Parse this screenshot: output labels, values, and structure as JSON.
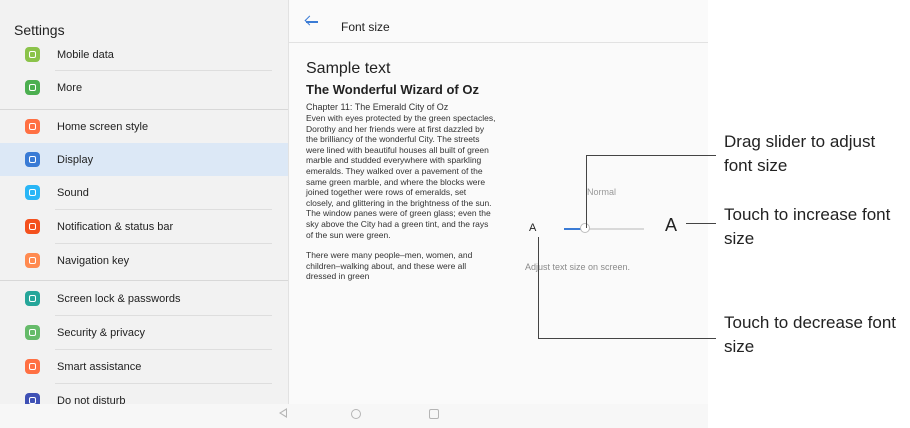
{
  "settings": {
    "header": "Settings",
    "items": [
      {
        "label": "Mobile data",
        "icon": "mobile-data-icon",
        "color": "#8bc34a"
      },
      {
        "label": "More",
        "icon": "more-icon",
        "color": "#4caf50"
      },
      {
        "label": "Home screen style",
        "icon": "home-screen-style-icon",
        "color": "#ff7043"
      },
      {
        "label": "Display",
        "icon": "display-icon",
        "color": "#3a7bd5"
      },
      {
        "label": "Sound",
        "icon": "sound-icon",
        "color": "#29b6f6"
      },
      {
        "label": "Notification & status bar",
        "icon": "notification-icon",
        "color": "#f4511e"
      },
      {
        "label": "Navigation key",
        "icon": "navigation-key-icon",
        "color": "#ff8a50"
      },
      {
        "label": "Screen lock & passwords",
        "icon": "screen-lock-icon",
        "color": "#26a69a"
      },
      {
        "label": "Security & privacy",
        "icon": "security-icon",
        "color": "#66bb6a"
      },
      {
        "label": "Smart assistance",
        "icon": "smart-assistance-icon",
        "color": "#ff7043"
      },
      {
        "label": "Do not disturb",
        "icon": "do-not-disturb-icon",
        "color": "#3f51b5"
      }
    ],
    "selected": "Display"
  },
  "font_size": {
    "title": "Font size",
    "sample_heading": "Sample text",
    "book_title": "The Wonderful Wizard of Oz",
    "chapter": "Chapter 11: The Emerald City of Oz",
    "paragraph1": "Even with eyes protected by the green spectacles, Dorothy and her friends were at first dazzled by the brilliancy of the wonderful City. The streets were lined with beautiful houses all built of green marble and studded everywhere with sparkling emeralds. They walked over a pavement of the same green marble, and where the blocks were joined together were rows of emeralds, set closely, and glittering in the brightness of the sun. The window panes were of green glass; even the sky above the City had a green tint, and the rays of the sun were green.",
    "paragraph2": "There were many people–men, women, and children–walking about, and these were all dressed in green",
    "level_label": "Normal",
    "small_a": "A",
    "large_a": "A",
    "slider_level": 0.25,
    "hint": "Adjust text size on screen."
  },
  "callouts": {
    "drag": "Drag slider to adjust font size",
    "increase": "Touch to increase font size",
    "decrease": "Touch to decrease font size"
  },
  "colors": {
    "accent": "#3a7bd5",
    "selected_row": "#dce8f6"
  }
}
